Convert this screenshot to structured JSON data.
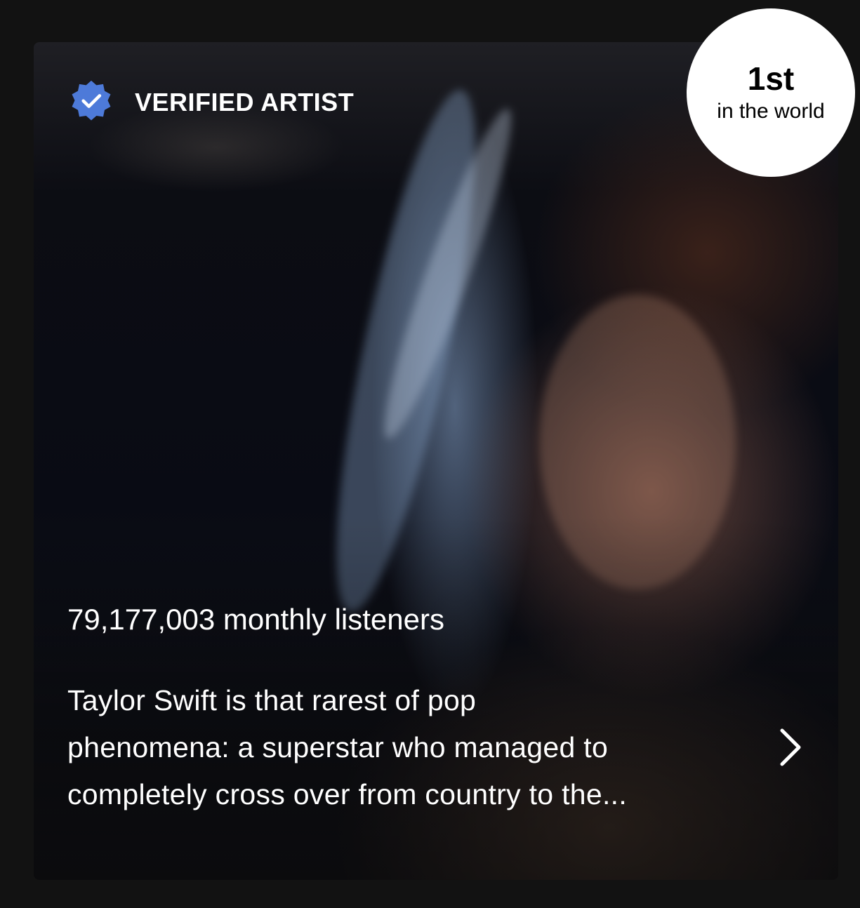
{
  "artist_card": {
    "verified_label": "VERIFIED ARTIST",
    "verified_icon": "verified-badge-icon",
    "monthly_listeners": "79,177,003 monthly listeners",
    "bio_lines": [
      "Taylor Swift is that rarest of pop",
      "phenomena: a superstar who managed to",
      "completely cross over from country to the..."
    ],
    "open_icon": "chevron-right-icon",
    "accent_color": "#4d7ad9"
  },
  "rank_badge": {
    "value": "1st",
    "label": "in the world"
  }
}
